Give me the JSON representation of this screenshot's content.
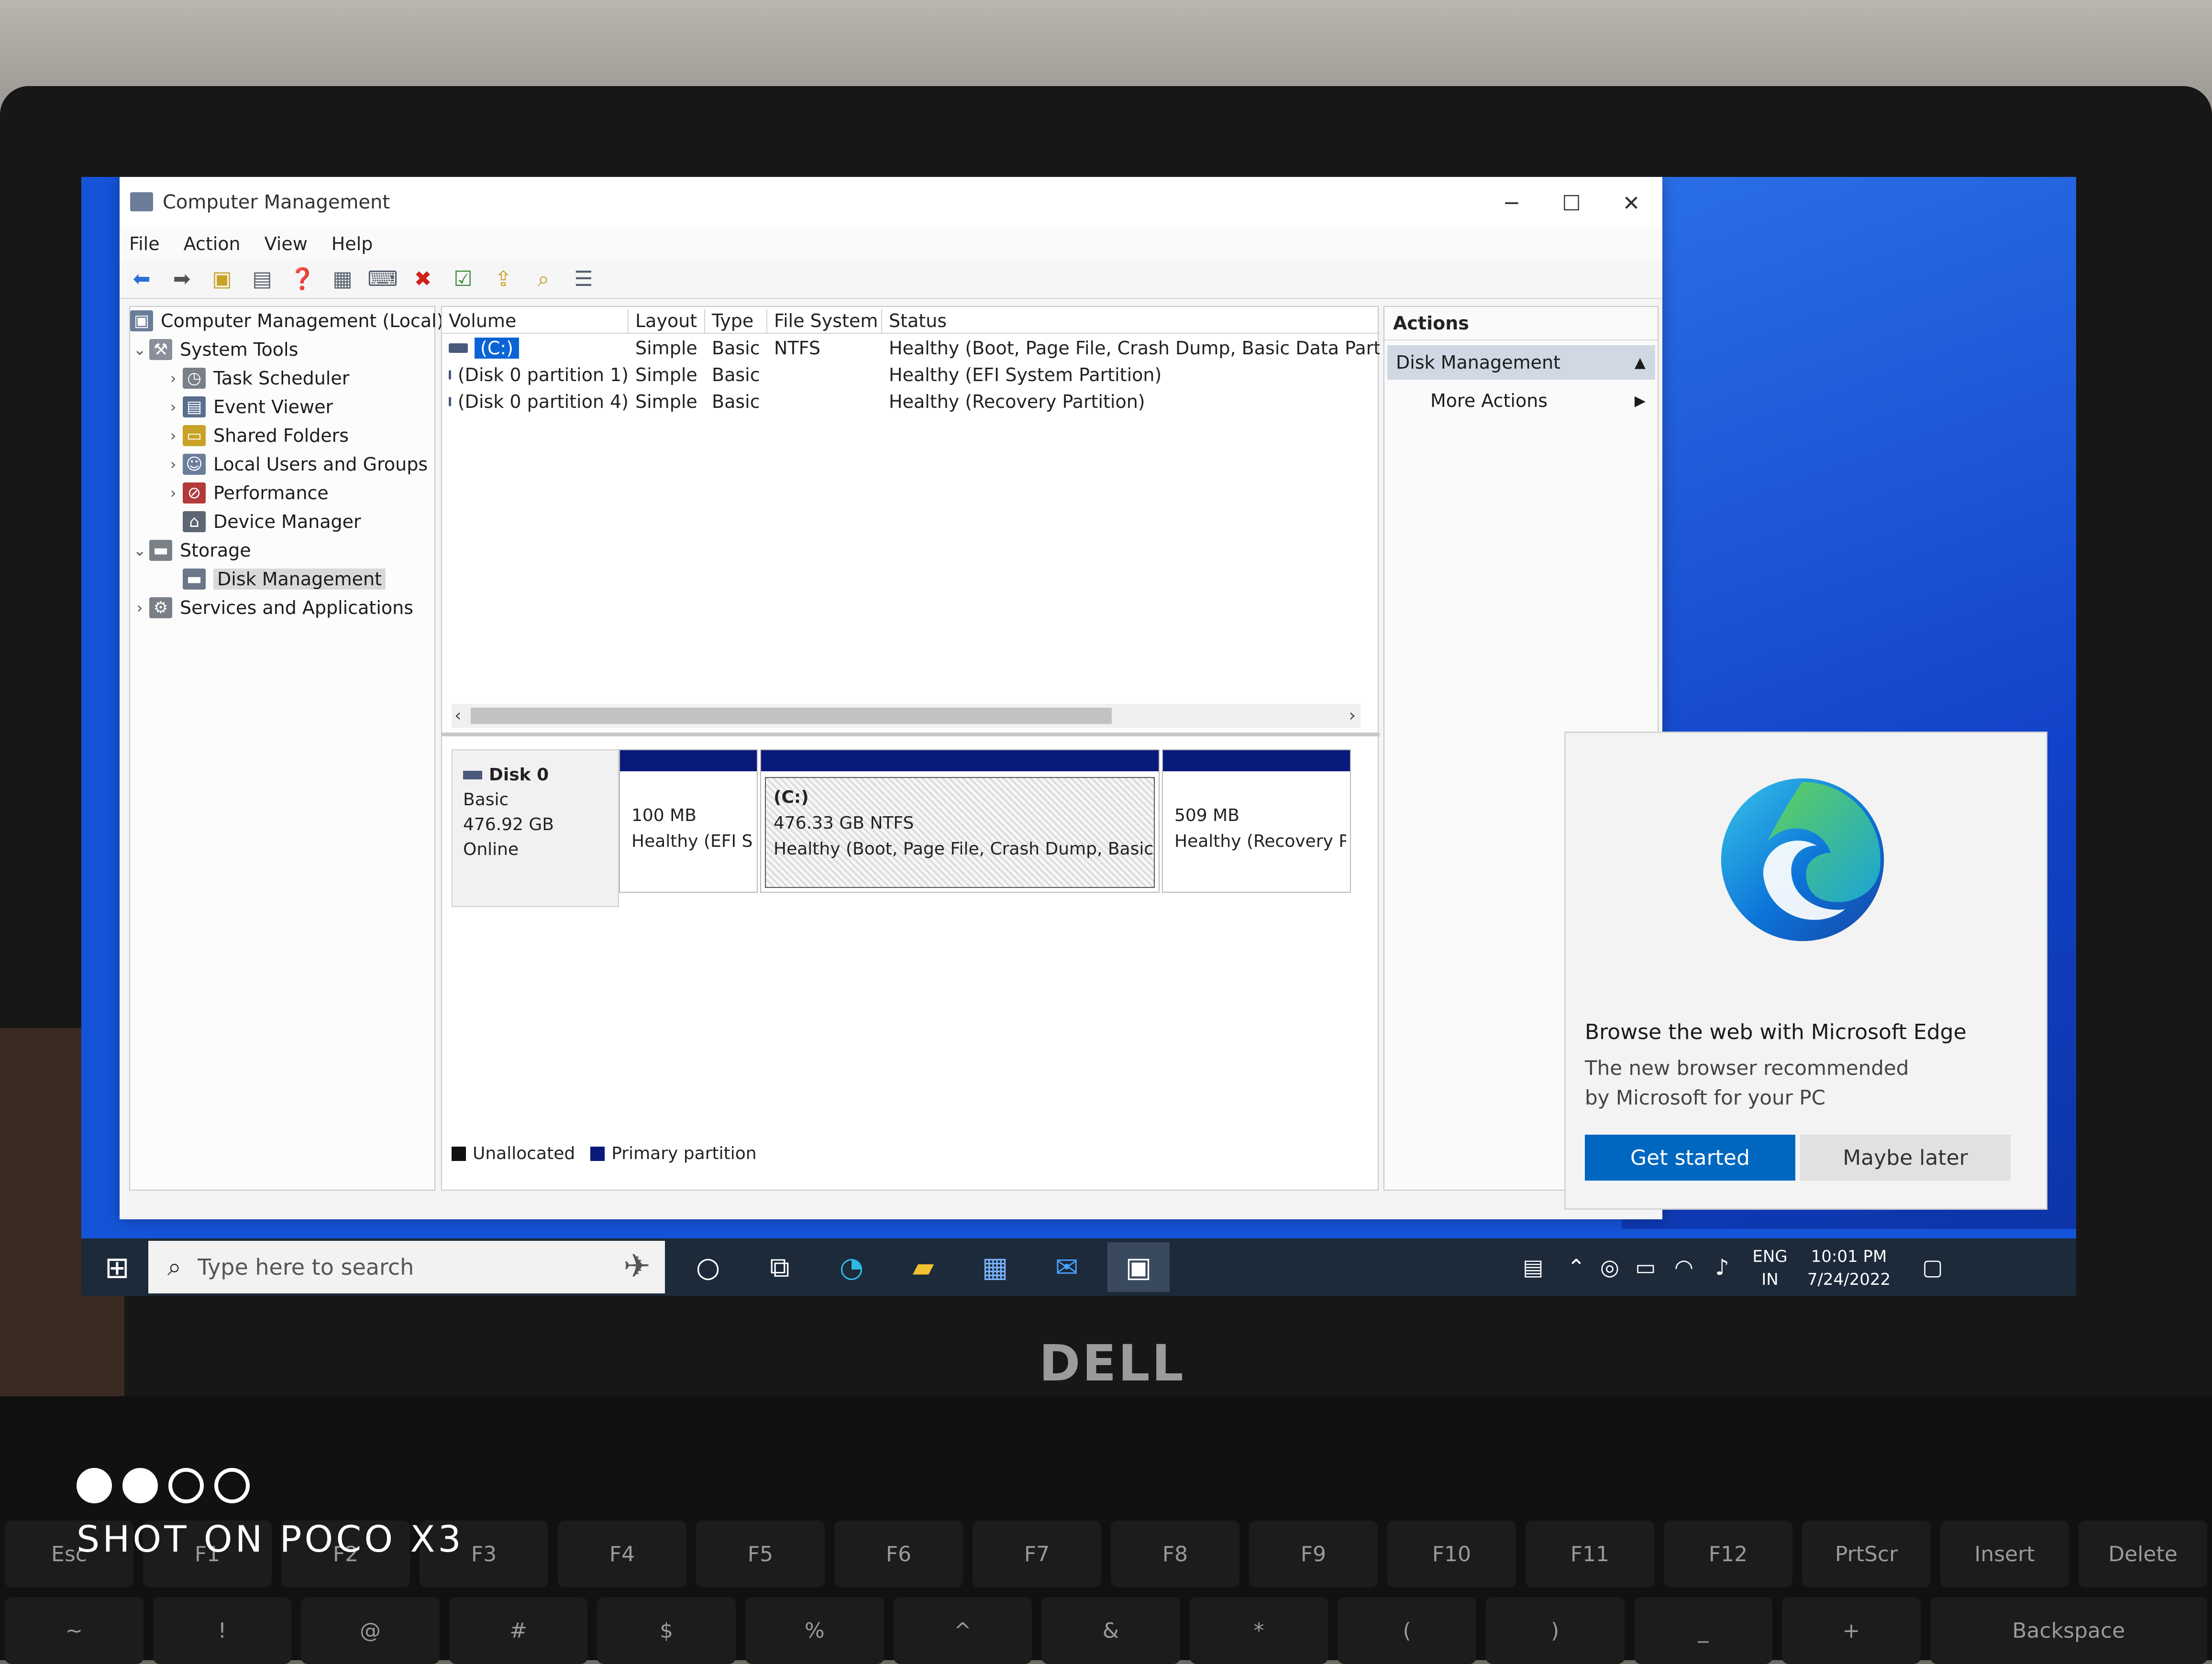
{
  "window": {
    "title": "Computer Management",
    "controls": {
      "minimize": "─",
      "maximize": "☐",
      "close": "✕"
    }
  },
  "menu": [
    "File",
    "Action",
    "View",
    "Help"
  ],
  "tree": {
    "root": "Computer Management (Local)",
    "system_tools": "System Tools",
    "task_scheduler": "Task Scheduler",
    "event_viewer": "Event Viewer",
    "shared_folders": "Shared Folders",
    "local_users": "Local Users and Groups",
    "performance": "Performance",
    "device_manager": "Device Manager",
    "storage": "Storage",
    "disk_management": "Disk Management",
    "services": "Services and Applications"
  },
  "volume_list": {
    "columns": [
      "Volume",
      "Layout",
      "Type",
      "File System",
      "Status"
    ],
    "rows": [
      {
        "volume": "(C:)",
        "layout": "Simple",
        "type": "Basic",
        "fs": "NTFS",
        "status": "Healthy (Boot, Page File, Crash Dump, Basic Data Partitior"
      },
      {
        "volume": "(Disk 0 partition 1)",
        "layout": "Simple",
        "type": "Basic",
        "fs": "",
        "status": "Healthy (EFI System Partition)"
      },
      {
        "volume": "(Disk 0 partition 4)",
        "layout": "Simple",
        "type": "Basic",
        "fs": "",
        "status": "Healthy (Recovery Partition)"
      }
    ]
  },
  "disk": {
    "name": "Disk 0",
    "type": "Basic",
    "size": "476.92 GB",
    "state": "Online",
    "partitions": [
      {
        "title": "",
        "size": "100 MB",
        "status": "Healthy (EFI Sy"
      },
      {
        "title": "(C:)",
        "size": "476.33 GB NTFS",
        "status": "Healthy (Boot, Page File, Crash Dump, Basic Da"
      },
      {
        "title": "",
        "size": "509 MB",
        "status": "Healthy (Recovery Pa"
      }
    ]
  },
  "legend": {
    "unallocated": "Unallocated",
    "primary": "Primary partition",
    "unallocated_color": "#111111",
    "primary_color": "#0a1a7c"
  },
  "actions": {
    "header": "Actions",
    "section": "Disk Management",
    "more": "More Actions"
  },
  "toast": {
    "title": "Browse the web with Microsoft Edge",
    "text": "The new browser recommended by Microsoft for your PC",
    "primary": "Get started",
    "secondary": "Maybe later"
  },
  "taskbar": {
    "search_placeholder": "Type here to search",
    "language_line1": "ENG",
    "language_line2": "IN",
    "time": "10:01 PM",
    "date": "7/24/2022"
  },
  "hardware": {
    "brand": "DELL",
    "function_keys": [
      "Esc",
      "F1",
      "F2",
      "F3",
      "F4",
      "F5",
      "F6",
      "F7",
      "F8",
      "F9",
      "F10",
      "F11",
      "F12",
      "PrtScr",
      "Insert",
      "Delete"
    ],
    "number_keys": [
      "~",
      "!",
      "@",
      "#",
      "$",
      "%",
      "^",
      "&",
      "*",
      "(",
      ")",
      "_",
      "+",
      "Backspace"
    ]
  },
  "watermark": "SHOT ON POCO X3",
  "colors": {
    "accent": "#0067c0",
    "desktop": "#1554d8",
    "selection": "#0a64d6",
    "partition_bar": "#0a1a7c"
  }
}
